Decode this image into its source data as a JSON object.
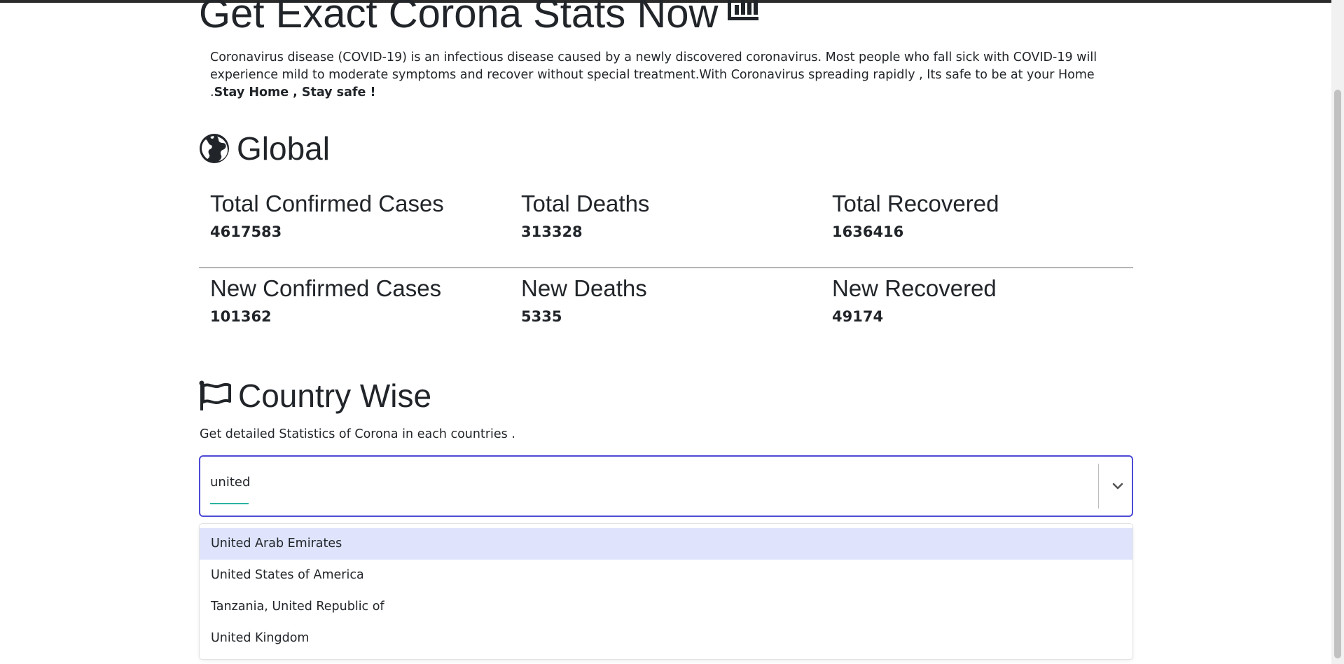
{
  "hero": {
    "title": "Get Exact Corona Stats Now",
    "intro_text": "Coronavirus disease (COVID-19) is an infectious disease caused by a newly discovered coronavirus. Most people who fall sick with COVID-19 will experience mild to moderate symptoms and recover without special treatment.With Coronavirus spreading rapidly , Its safe to be at your Home .",
    "intro_emphasis": "Stay Home , Stay safe !",
    "icon": "bar-chart-icon"
  },
  "global": {
    "heading": "Global",
    "icon": "globe-icon",
    "totals": [
      {
        "label": "Total Confirmed Cases",
        "value": "4617583"
      },
      {
        "label": "Total Deaths",
        "value": "313328"
      },
      {
        "label": "Total Recovered",
        "value": "1636416"
      }
    ],
    "new": [
      {
        "label": "New Confirmed Cases",
        "value": "101362"
      },
      {
        "label": "New Deaths",
        "value": "5335"
      },
      {
        "label": "New Recovered",
        "value": "49174"
      }
    ]
  },
  "country": {
    "heading": "Country Wise",
    "icon": "flag-icon",
    "subtitle": "Get detailed Statistics of Corona in each countries .",
    "search_value": "united",
    "dropdown_icon": "chevron-down-icon",
    "options": [
      "United Arab Emirates",
      "United States of America",
      "Tanzania, United Republic of",
      "United Kingdom"
    ],
    "highlighted_option": "United Arab Emirates"
  },
  "colors": {
    "focus_border": "#4d4bd6",
    "option_highlight": "#dfe4fc",
    "input_underline": "#2bb3a0"
  }
}
